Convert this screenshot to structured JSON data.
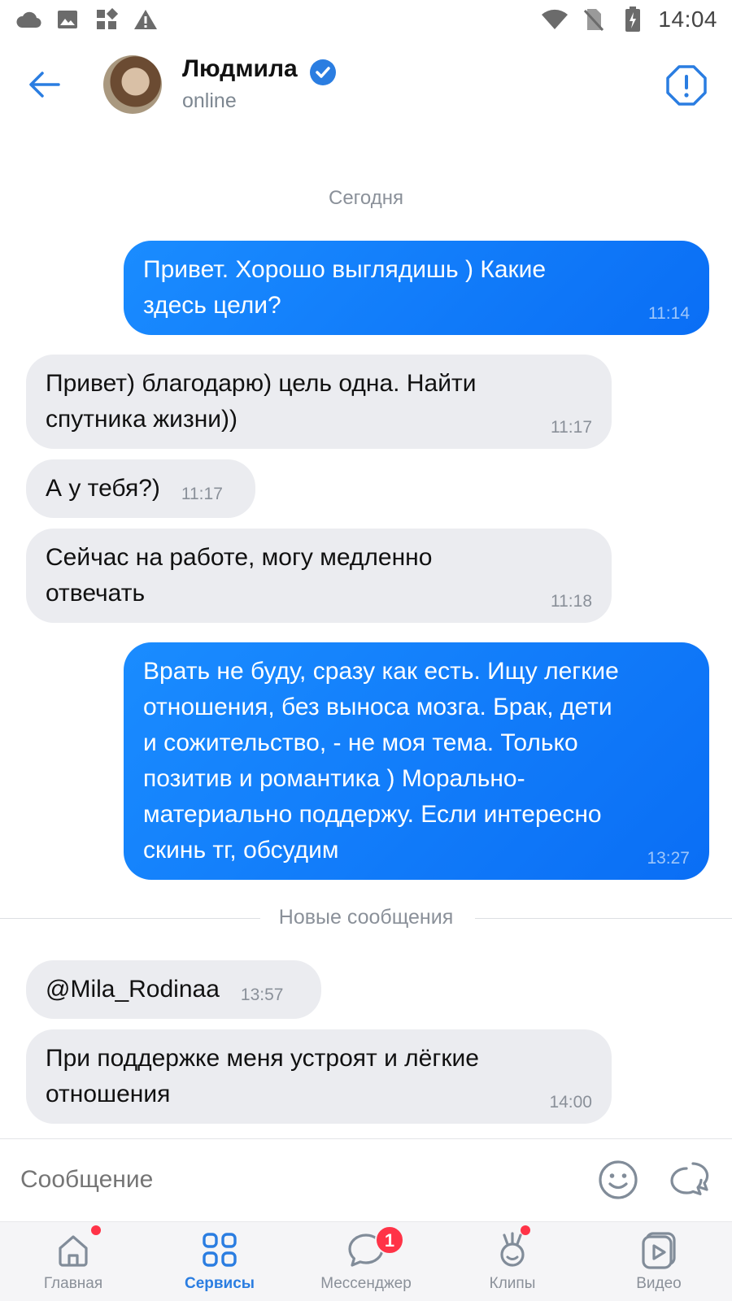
{
  "status_bar": {
    "time": "14:04",
    "left_icons": [
      "cloud-icon",
      "image-icon",
      "apps-icon",
      "warning-icon"
    ],
    "right_icons": [
      "wifi-icon",
      "no-sim-icon",
      "battery-icon"
    ]
  },
  "header": {
    "name": "Людмила",
    "status": "online",
    "verified": true
  },
  "chat": {
    "date_separator": "Сегодня",
    "new_messages_separator": "Новые сообщения",
    "messages": [
      {
        "direction": "out",
        "text": "Привет. Хорошо выглядишь ) Какие\nздесь цели?",
        "time": "11:14"
      },
      {
        "direction": "in",
        "text": "Привет) благодарю) цель одна. Найти\nспутника жизни))",
        "time": "11:17"
      },
      {
        "direction": "in",
        "text": "А у тебя?)",
        "time": "11:17"
      },
      {
        "direction": "in",
        "text": "Сейчас на работе, могу медленно\nотвечать",
        "time": "11:18"
      },
      {
        "direction": "out",
        "text": "Врать не буду, сразу как есть. Ищу легкие\nотношения, без выноса мозга. Брак, дети\nи сожительство, - не моя тема. Только\nпозитив и романтика ) Морально-\nматериально поддержу. Если интересно\nскинь тг, обсудим",
        "time": "13:27"
      },
      {
        "direction": "in",
        "text": "@Mila_Rodinaa",
        "time": "13:57"
      },
      {
        "direction": "in",
        "text": "При поддержке меня устроят и лёгкие\nотношения",
        "time": "14:00"
      }
    ]
  },
  "composer": {
    "placeholder": "Сообщение"
  },
  "bottom_nav": {
    "items": [
      {
        "label": "Главная",
        "icon": "home-icon",
        "active": false,
        "dot": true
      },
      {
        "label": "Сервисы",
        "icon": "services-icon",
        "active": true,
        "dot": false
      },
      {
        "label": "Мессенджер",
        "icon": "messenger-icon",
        "active": false,
        "badge": "1"
      },
      {
        "label": "Клипы",
        "icon": "clips-icon",
        "active": false,
        "dot": true
      },
      {
        "label": "Видео",
        "icon": "video-icon",
        "active": false,
        "dot": false
      }
    ]
  },
  "colors": {
    "accent": "#2a7de1",
    "outgoing_bubble": "#0a6ef5",
    "incoming_bubble": "#ebecf0",
    "badge": "#ff3347"
  }
}
